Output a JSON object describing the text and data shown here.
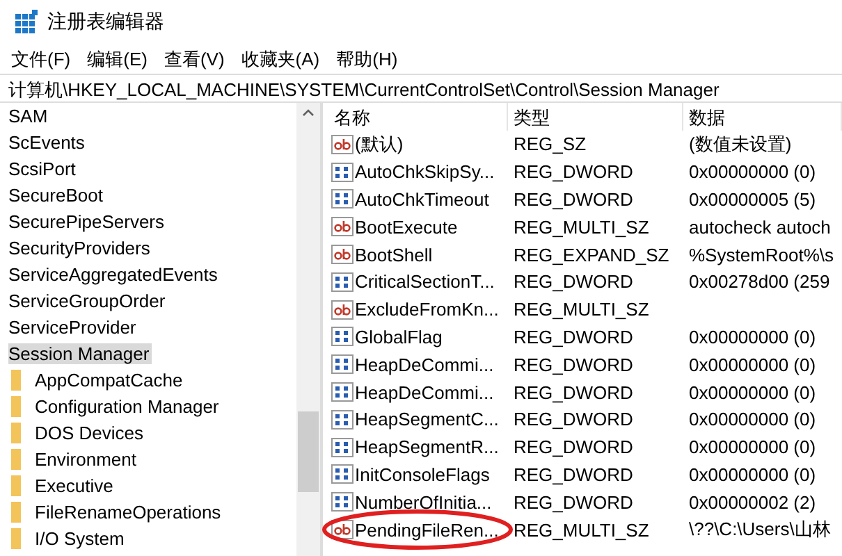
{
  "window": {
    "title": "注册表编辑器"
  },
  "menu": [
    {
      "label": "文件(F)"
    },
    {
      "label": "编辑(E)"
    },
    {
      "label": "查看(V)"
    },
    {
      "label": "收藏夹(A)"
    },
    {
      "label": "帮助(H)"
    }
  ],
  "address": "计算机\\HKEY_LOCAL_MACHINE\\SYSTEM\\CurrentControlSet\\Control\\Session Manager",
  "tree": [
    {
      "label": "SAM",
      "selected": false
    },
    {
      "label": "ScEvents",
      "selected": false
    },
    {
      "label": "ScsiPort",
      "selected": false
    },
    {
      "label": "SecureBoot",
      "selected": false
    },
    {
      "label": "SecurePipeServers",
      "selected": false
    },
    {
      "label": "SecurityProviders",
      "selected": false
    },
    {
      "label": "ServiceAggregatedEvents",
      "selected": false
    },
    {
      "label": "ServiceGroupOrder",
      "selected": false
    },
    {
      "label": "ServiceProvider",
      "selected": false
    },
    {
      "label": "Session Manager",
      "selected": true,
      "children": [
        {
          "label": "AppCompatCache",
          "selected": false
        },
        {
          "label": "Configuration Manager",
          "selected": false
        },
        {
          "label": "DOS Devices",
          "selected": false
        },
        {
          "label": "Environment",
          "selected": false
        },
        {
          "label": "Executive",
          "selected": false
        },
        {
          "label": "FileRenameOperations",
          "selected": false
        },
        {
          "label": "I/O System",
          "selected": false
        }
      ]
    }
  ],
  "table": {
    "columns": [
      "名称",
      "类型",
      "数据"
    ],
    "rows": [
      {
        "kind": "string",
        "name": "(默认)",
        "type": "REG_SZ",
        "data": "(数值未设置)",
        "highlighted": false
      },
      {
        "kind": "binary",
        "name": "AutoChkSkipSy...",
        "type": "REG_DWORD",
        "data": "0x00000000 (0)",
        "highlighted": false
      },
      {
        "kind": "binary",
        "name": "AutoChkTimeout",
        "type": "REG_DWORD",
        "data": "0x00000005 (5)",
        "highlighted": false
      },
      {
        "kind": "string",
        "name": "BootExecute",
        "type": "REG_MULTI_SZ",
        "data": "autocheck autoch",
        "highlighted": false
      },
      {
        "kind": "string",
        "name": "BootShell",
        "type": "REG_EXPAND_SZ",
        "data": "%SystemRoot%\\s",
        "highlighted": false
      },
      {
        "kind": "binary",
        "name": "CriticalSectionT...",
        "type": "REG_DWORD",
        "data": "0x00278d00 (259",
        "highlighted": false
      },
      {
        "kind": "string",
        "name": "ExcludeFromKn...",
        "type": "REG_MULTI_SZ",
        "data": "",
        "highlighted": false
      },
      {
        "kind": "binary",
        "name": "GlobalFlag",
        "type": "REG_DWORD",
        "data": "0x00000000 (0)",
        "highlighted": false
      },
      {
        "kind": "binary",
        "name": "HeapDeCommi...",
        "type": "REG_DWORD",
        "data": "0x00000000 (0)",
        "highlighted": false
      },
      {
        "kind": "binary",
        "name": "HeapDeCommi...",
        "type": "REG_DWORD",
        "data": "0x00000000 (0)",
        "highlighted": false
      },
      {
        "kind": "binary",
        "name": "HeapSegmentC...",
        "type": "REG_DWORD",
        "data": "0x00000000 (0)",
        "highlighted": false
      },
      {
        "kind": "binary",
        "name": "HeapSegmentR...",
        "type": "REG_DWORD",
        "data": "0x00000000 (0)",
        "highlighted": false
      },
      {
        "kind": "binary",
        "name": "InitConsoleFlags",
        "type": "REG_DWORD",
        "data": "0x00000000 (0)",
        "highlighted": false
      },
      {
        "kind": "binary",
        "name": "NumberOfInitia...",
        "type": "REG_DWORD",
        "data": "0x00000002 (2)",
        "highlighted": false
      },
      {
        "kind": "string",
        "name": "PendingFileRen...",
        "type": "REG_MULTI_SZ",
        "data": "\\??\\C:\\Users\\山林",
        "highlighted": true
      }
    ]
  }
}
